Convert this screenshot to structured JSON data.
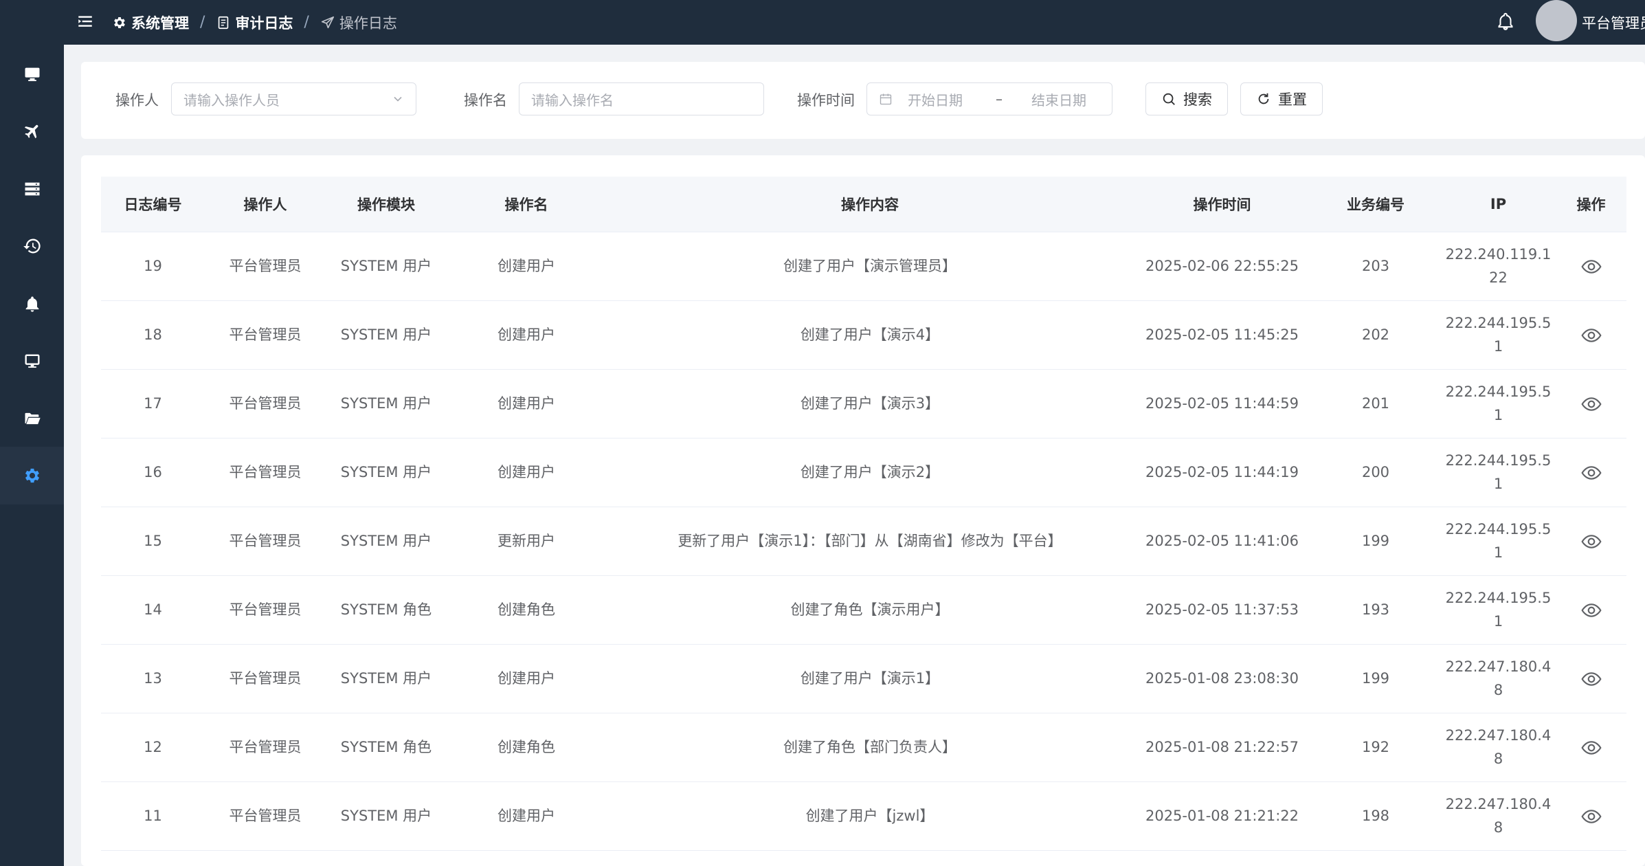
{
  "breadcrumb": {
    "level1": "系统管理",
    "level2": "审计日志",
    "level3": "操作日志"
  },
  "user": {
    "name": "平台管理员"
  },
  "search": {
    "operator_label": "操作人",
    "operator_placeholder": "请输入操作人员",
    "opname_label": "操作名",
    "opname_placeholder": "请输入操作名",
    "time_label": "操作时间",
    "start_placeholder": "开始日期",
    "range_sep": "–",
    "end_placeholder": "结束日期",
    "search_button": "搜索",
    "reset_button": "重置"
  },
  "table": {
    "headers": [
      "日志编号",
      "操作人",
      "操作模块",
      "操作名",
      "操作内容",
      "操作时间",
      "业务编号",
      "IP",
      "操作"
    ],
    "rows": [
      {
        "id": "19",
        "operator": "平台管理员",
        "module": "SYSTEM 用户",
        "name": "创建用户",
        "content": "创建了用户【演示管理员】",
        "time": "2025-02-06 22:55:25",
        "biz": "203",
        "ip": "222.240.119.122"
      },
      {
        "id": "18",
        "operator": "平台管理员",
        "module": "SYSTEM 用户",
        "name": "创建用户",
        "content": "创建了用户【演示4】",
        "time": "2025-02-05 11:45:25",
        "biz": "202",
        "ip": "222.244.195.51"
      },
      {
        "id": "17",
        "operator": "平台管理员",
        "module": "SYSTEM 用户",
        "name": "创建用户",
        "content": "创建了用户【演示3】",
        "time": "2025-02-05 11:44:59",
        "biz": "201",
        "ip": "222.244.195.51"
      },
      {
        "id": "16",
        "operator": "平台管理员",
        "module": "SYSTEM 用户",
        "name": "创建用户",
        "content": "创建了用户【演示2】",
        "time": "2025-02-05 11:44:19",
        "biz": "200",
        "ip": "222.244.195.51"
      },
      {
        "id": "15",
        "operator": "平台管理员",
        "module": "SYSTEM 用户",
        "name": "更新用户",
        "content": "更新了用户【演示1】：【部门】从【湖南省】修改为【平台】",
        "time": "2025-02-05 11:41:06",
        "biz": "199",
        "ip": "222.244.195.51"
      },
      {
        "id": "14",
        "operator": "平台管理员",
        "module": "SYSTEM 角色",
        "name": "创建角色",
        "content": "创建了角色【演示用户】",
        "time": "2025-02-05 11:37:53",
        "biz": "193",
        "ip": "222.244.195.51"
      },
      {
        "id": "13",
        "operator": "平台管理员",
        "module": "SYSTEM 用户",
        "name": "创建用户",
        "content": "创建了用户【演示1】",
        "time": "2025-01-08 23:08:30",
        "biz": "199",
        "ip": "222.247.180.48"
      },
      {
        "id": "12",
        "operator": "平台管理员",
        "module": "SYSTEM 角色",
        "name": "创建角色",
        "content": "创建了角色【部门负责人】",
        "time": "2025-01-08 21:22:57",
        "biz": "192",
        "ip": "222.247.180.48"
      },
      {
        "id": "11",
        "operator": "平台管理员",
        "module": "SYSTEM 用户",
        "name": "创建用户",
        "content": "创建了用户【jzwl】",
        "time": "2025-01-08 21:21:22",
        "biz": "198",
        "ip": "222.247.180.48"
      }
    ]
  },
  "colors": {
    "sidebar_bg": "#1f2d3d",
    "active_icon": "#409eff",
    "icon_white": "#ffffff"
  }
}
